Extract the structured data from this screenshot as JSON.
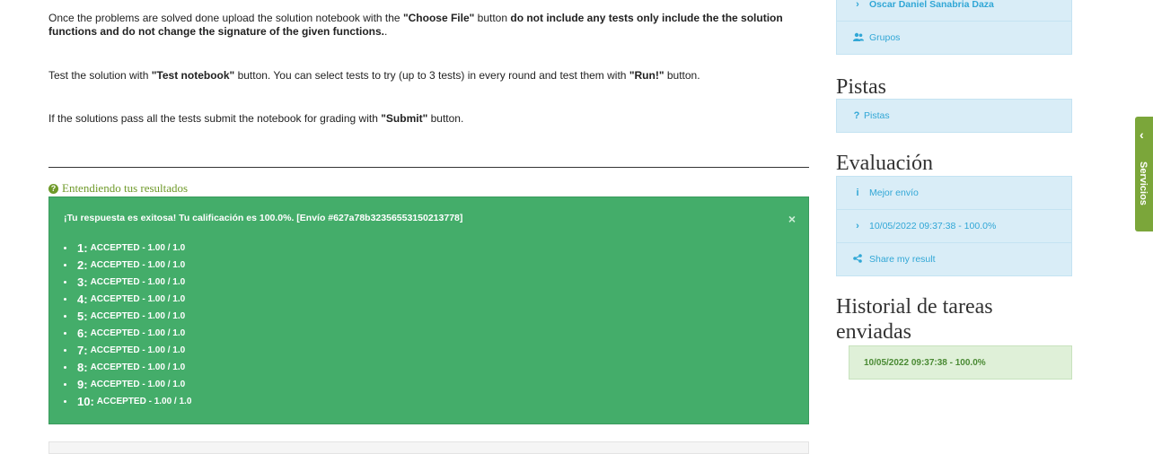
{
  "instructions": {
    "p1_a": "Once the problems are solved done upload the solution notebook with the ",
    "p1_b": "\"Choose File\"",
    "p1_c": " button ",
    "p1_d": "do not include any tests only include the the solution functions and do not change the signature of the given functions.",
    "p1_e": ".",
    "p2_a": "Test the solution with ",
    "p2_b": "\"Test notebook\"",
    "p2_c": " button. You can select tests to try (up to 3 tests) in every round and test them with ",
    "p2_d": "\"Run!\"",
    "p2_e": " button.",
    "p3_a": "If the solutions pass all the tests submit the notebook for grading with ",
    "p3_b": "\"Submit\"",
    "p3_c": " button."
  },
  "understand_link": "Entendiendo tus resultados",
  "result": {
    "title": "¡Tu respuesta es exitosa! Tu calificación es 100.0%. [Envío #627a78b32356553150213778]",
    "close": "×",
    "tests": [
      {
        "num": "1:",
        "status": "ACCEPTED - 1.00 / 1.0"
      },
      {
        "num": "2:",
        "status": "ACCEPTED - 1.00 / 1.0"
      },
      {
        "num": "3:",
        "status": "ACCEPTED - 1.00 / 1.0"
      },
      {
        "num": "4:",
        "status": "ACCEPTED - 1.00 / 1.0"
      },
      {
        "num": "5:",
        "status": "ACCEPTED - 1.00 / 1.0"
      },
      {
        "num": "6:",
        "status": "ACCEPTED - 1.00 / 1.0"
      },
      {
        "num": "7:",
        "status": "ACCEPTED - 1.00 / 1.0"
      },
      {
        "num": "8:",
        "status": "ACCEPTED - 1.00 / 1.0"
      },
      {
        "num": "9:",
        "status": "ACCEPTED - 1.00 / 1.0"
      },
      {
        "num": "10:",
        "status": "ACCEPTED - 1.00 / 1.0"
      }
    ]
  },
  "sidebar": {
    "user_name": "Oscar Daniel Sanabria Daza",
    "groups": "Grupos",
    "pistas_title": "Pistas",
    "pistas_link": "Pistas",
    "eval_title": "Evaluación",
    "best_submission": "Mejor envío",
    "submission_item": "10/05/2022 09:37:38 - 100.0%",
    "share": "Share my result",
    "history_title_1": "Historial de tareas",
    "history_title_2": "enviadas",
    "history_item": "10/05/2022 09:37:38 - 100.0%"
  },
  "servicios_tab": "Servicios",
  "colors": {
    "success_alert": "#44ad6a",
    "info_box": "#d9edf7",
    "link_blue": "#31a7d6",
    "green_accent": "#7ba63a"
  }
}
